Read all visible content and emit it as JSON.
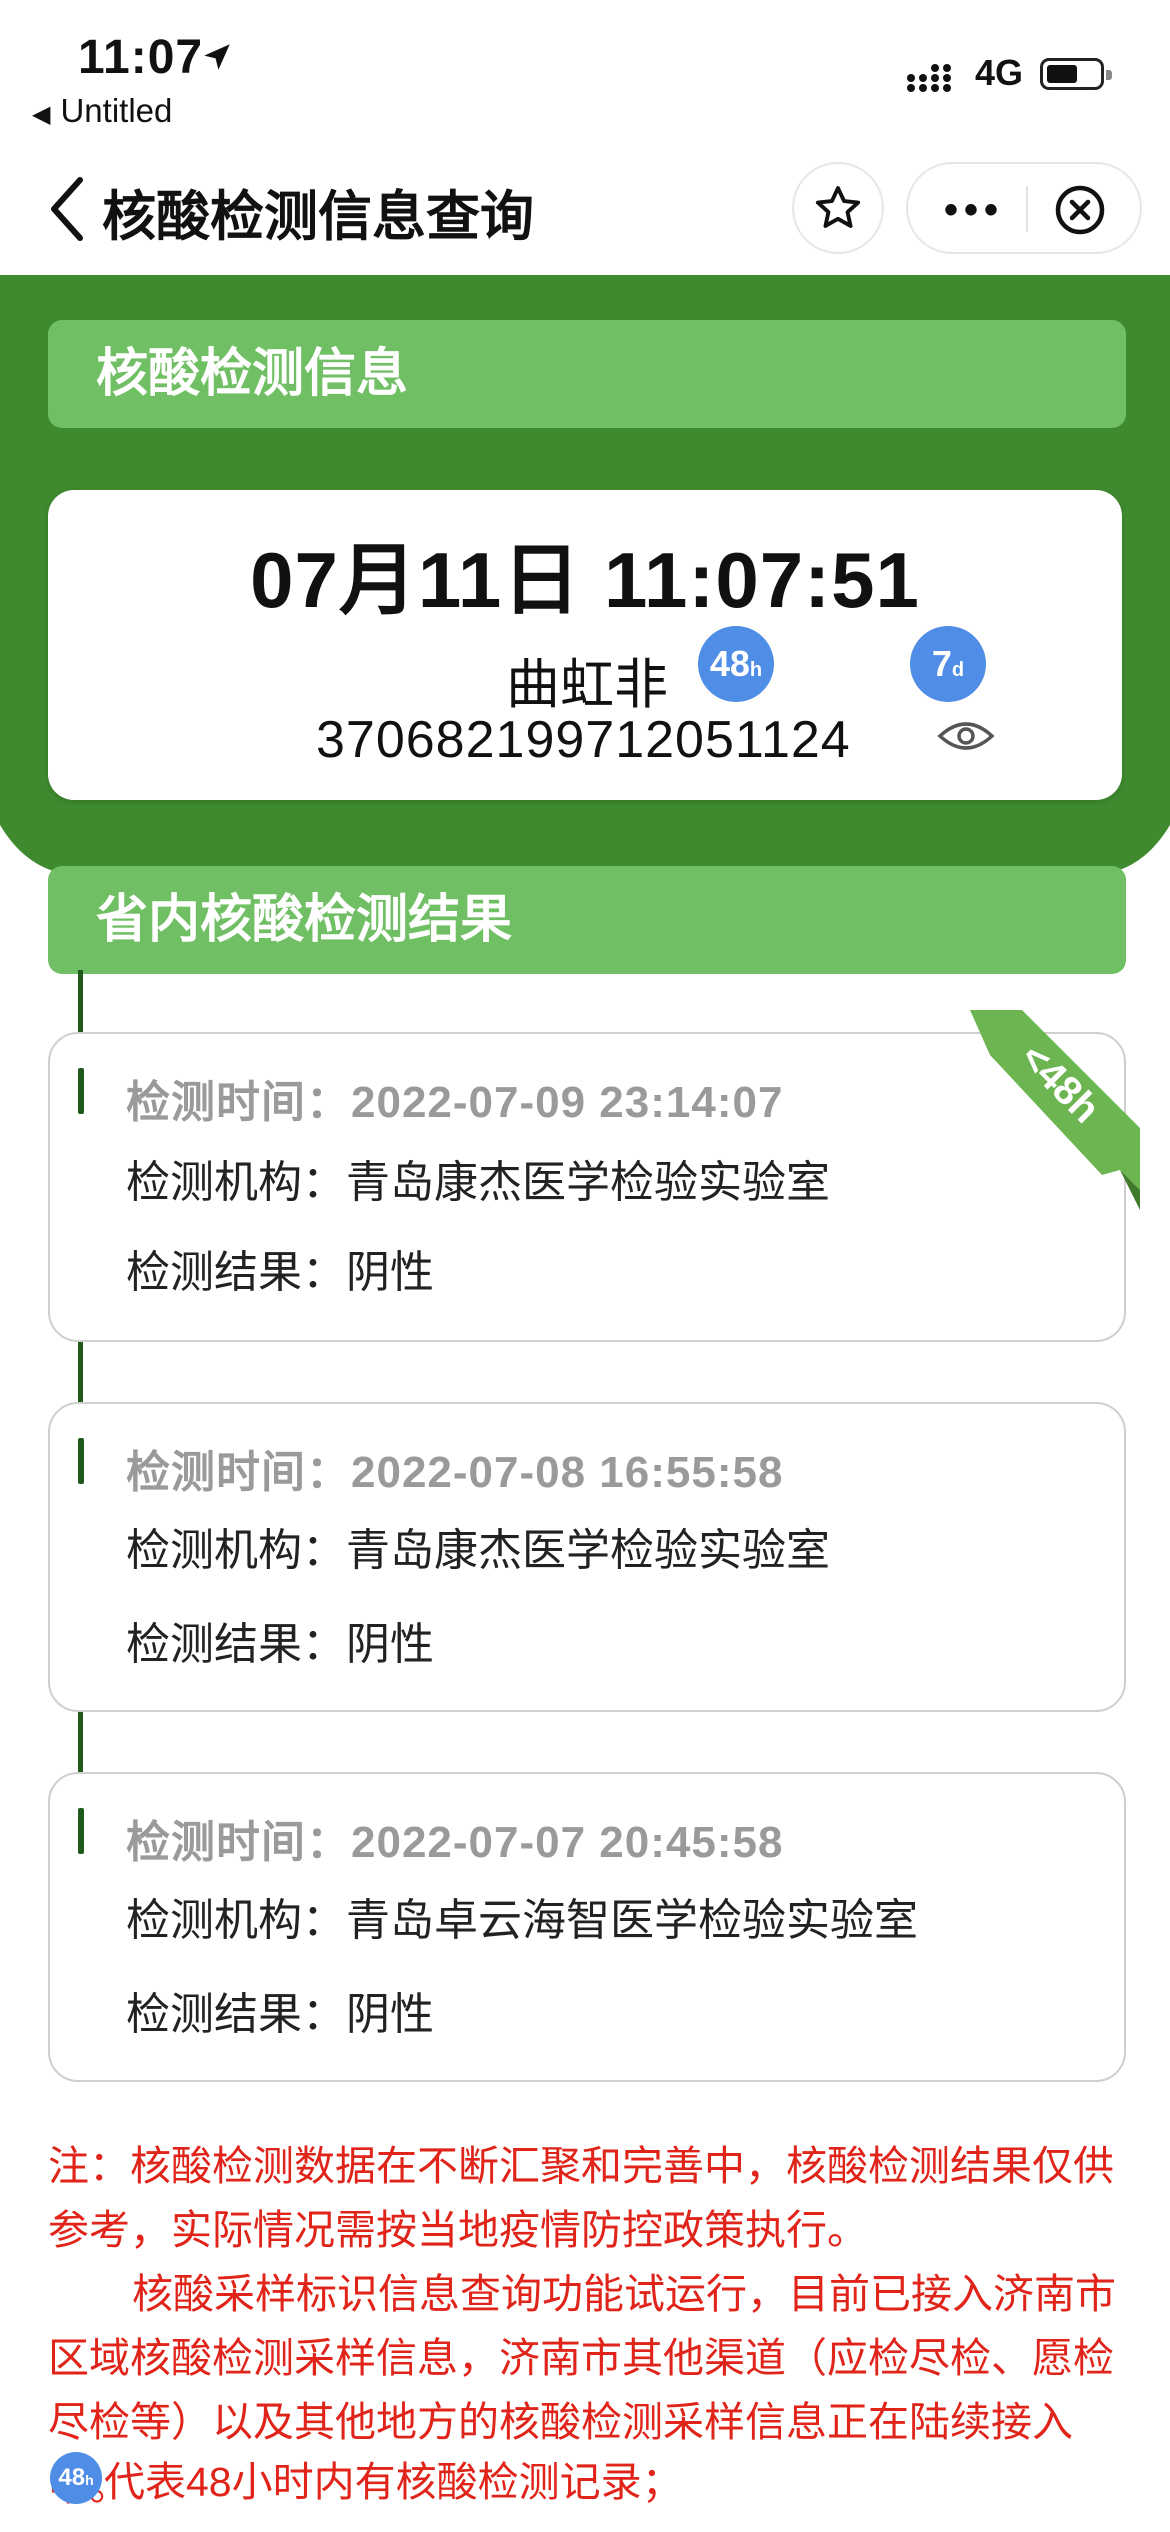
{
  "status_bar": {
    "time": "11:07",
    "back_app": "Untitled",
    "network": "4G"
  },
  "nav": {
    "title": "核酸检测信息查询"
  },
  "header": {
    "section_title": "核酸检测信息",
    "datetime": "07月11日 11:07:51",
    "name": "曲虹非",
    "badge_48h": {
      "value": "48",
      "unit": "h"
    },
    "badge_7d": {
      "value": "7",
      "unit": "d"
    },
    "id_number": "370682199712051124"
  },
  "results": {
    "section_title": "省内核酸检测结果",
    "ribbon_label": "<48h",
    "labels": {
      "time": "检测时间：",
      "org": "检测机构：",
      "result": "检测结果："
    },
    "items": [
      {
        "time": "2022-07-09 23:14:07",
        "org": "青岛康杰医学检验实验室",
        "result": "阴性"
      },
      {
        "time": "2022-07-08 16:55:58",
        "org": "青岛康杰医学检验实验室",
        "result": "阴性"
      },
      {
        "time": "2022-07-07 20:45:58",
        "org": "青岛卓云海智医学检验实验室",
        "result": "阴性"
      }
    ]
  },
  "notes": {
    "line1": "注：核酸检测数据在不断汇聚和完善中，核酸检测结果仅供参考，实际情况需按当地疫情防控政策执行。",
    "line2": "核酸采样标识信息查询功能试运行，目前已接入济南市区域核酸检测采样信息，济南市其他渠道（应检尽检、愿检尽检等）以及其他地方的核酸检测采样信息正在陆续接入中。",
    "legend_badge": {
      "value": "48",
      "unit": "h"
    },
    "legend_text": "代表48小时内有核酸检测记录；"
  },
  "colors": {
    "header_green": "#3f8a2f",
    "bar_green": "#71bf64",
    "badge_blue": "#4f8de6",
    "note_red": "#e0241a"
  }
}
